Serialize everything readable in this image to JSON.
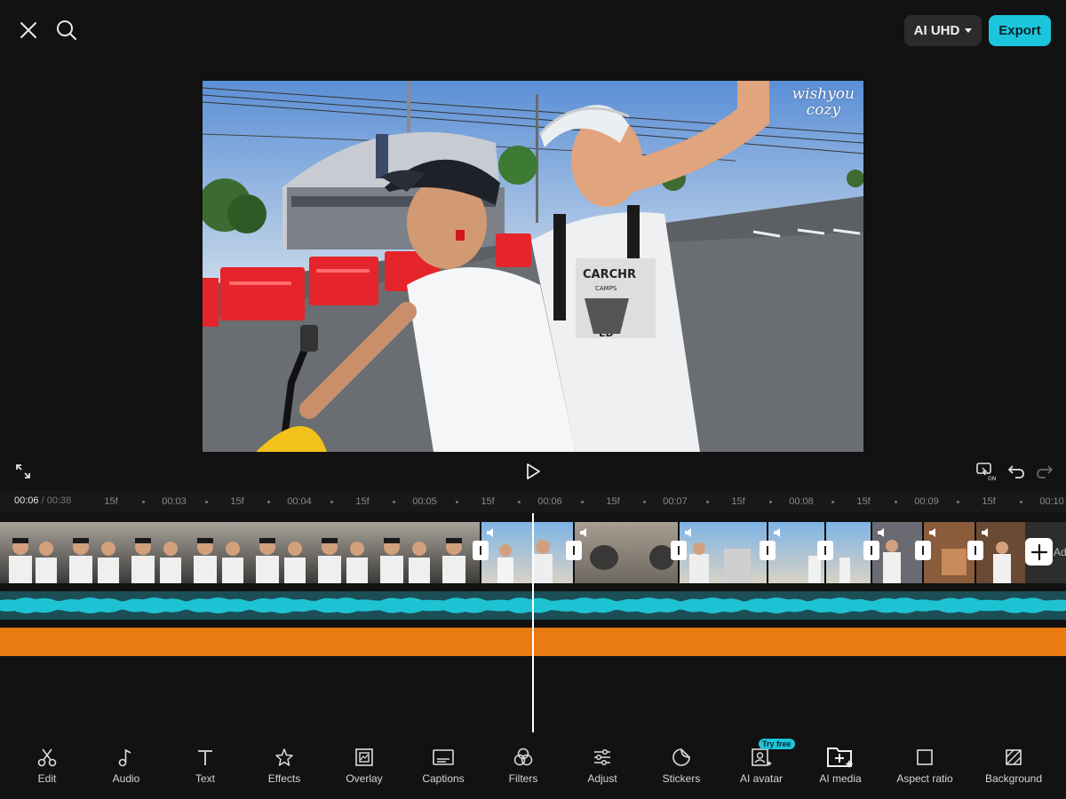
{
  "topbar": {
    "close_icon": "close-icon",
    "search_icon": "search-icon",
    "quality_label": "AI UHD",
    "export_label": "Export"
  },
  "preview": {
    "watermark_line1": "wishyou",
    "watermark_line2": "cozy",
    "shirt_text_1": "CARCHR",
    "shirt_text_2": "CAMPS",
    "shirt_text_3": "ED"
  },
  "timeline": {
    "current_time": "00:06",
    "separator": "/",
    "total_time": "00:38",
    "ticks": [
      {
        "label": "15f",
        "pos": 125
      },
      {
        "label": "00:03",
        "pos": 196
      },
      {
        "label": "15f",
        "pos": 267
      },
      {
        "label": "00:04",
        "pos": 337
      },
      {
        "label": "15f",
        "pos": 408
      },
      {
        "label": "00:05",
        "pos": 478
      },
      {
        "label": "15f",
        "pos": 549
      },
      {
        "label": "00:06",
        "pos": 619
      },
      {
        "label": "15f",
        "pos": 690
      },
      {
        "label": "00:07",
        "pos": 760
      },
      {
        "label": "15f",
        "pos": 831
      },
      {
        "label": "00:08",
        "pos": 902
      },
      {
        "label": "15f",
        "pos": 972
      },
      {
        "label": "00:09",
        "pos": 1043
      },
      {
        "label": "15f",
        "pos": 1113
      },
      {
        "label": "00:10",
        "pos": 1184
      }
    ],
    "add_label": "Add"
  },
  "toolbar": {
    "items": [
      {
        "label": "Edit",
        "icon": "scissors-icon"
      },
      {
        "label": "Audio",
        "icon": "music-note-icon"
      },
      {
        "label": "Text",
        "icon": "text-icon"
      },
      {
        "label": "Effects",
        "icon": "effects-star-icon"
      },
      {
        "label": "Overlay",
        "icon": "overlay-icon"
      },
      {
        "label": "Captions",
        "icon": "captions-icon"
      },
      {
        "label": "Filters",
        "icon": "filters-icon"
      },
      {
        "label": "Adjust",
        "icon": "adjust-sliders-icon"
      },
      {
        "label": "Stickers",
        "icon": "sticker-icon"
      },
      {
        "label": "AI avatar",
        "icon": "ai-avatar-icon"
      },
      {
        "label": "AI media",
        "icon": "ai-media-icon"
      },
      {
        "label": "Aspect ratio",
        "icon": "aspect-ratio-icon"
      },
      {
        "label": "Background",
        "icon": "background-icon"
      }
    ],
    "try_free_badge": "Try free"
  },
  "colors": {
    "accent": "#1bc6dc",
    "audio_wave": "#1ec3d3",
    "audio_track_bg": "#1c4e56",
    "orange_track": "#ea7a12",
    "background": "#121212"
  }
}
